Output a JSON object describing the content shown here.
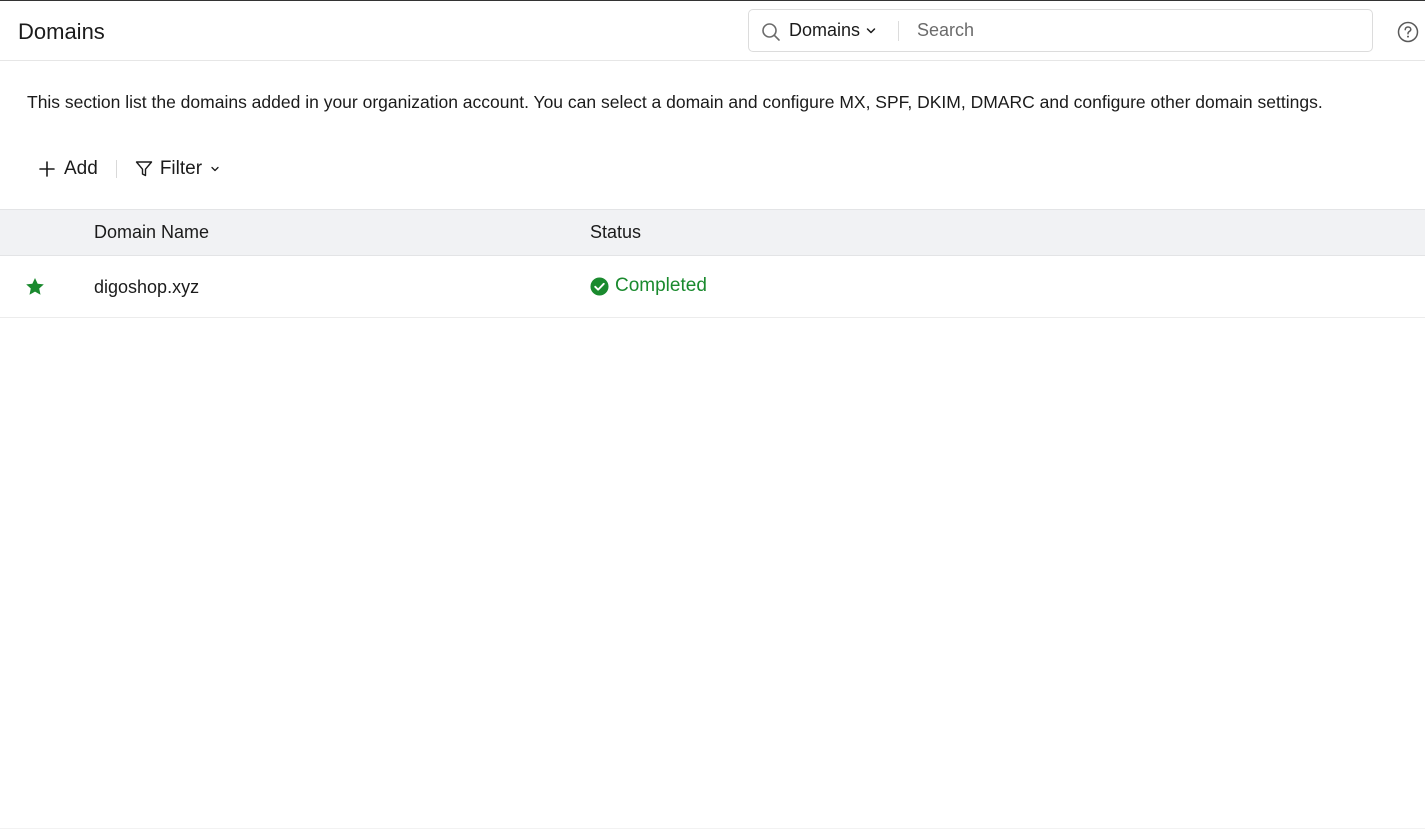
{
  "header": {
    "title": "Domains",
    "search": {
      "scope": "Domains",
      "placeholder": "Search",
      "value": ""
    },
    "help_icon": "help-circle-icon"
  },
  "description": "This section list the domains added in your organization account. You can select a domain and configure MX, SPF, DKIM, DMARC and configure other domain settings.",
  "toolbar": {
    "add_label": "Add",
    "filter_label": "Filter"
  },
  "table": {
    "columns": [
      "Domain Name",
      "Status"
    ],
    "rows": [
      {
        "starred": true,
        "domain": "digoshop.xyz",
        "status": "Completed"
      }
    ]
  },
  "colors": {
    "status_completed": "#1a8a2e",
    "star": "#1a8a2e",
    "header_bg": "#f1f2f4"
  }
}
